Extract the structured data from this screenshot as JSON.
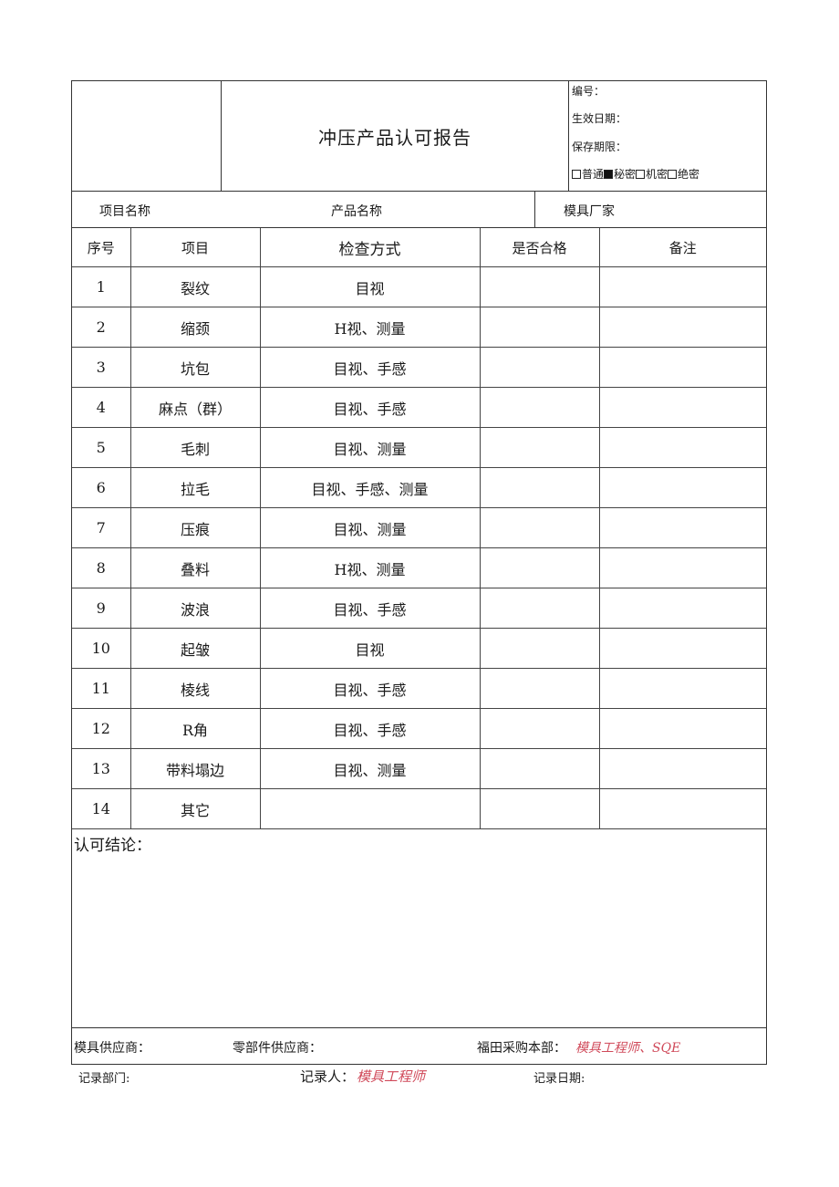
{
  "header": {
    "title": "冲压产品认可报告",
    "meta": {
      "number_label": "编号：",
      "effective_date_label": "生效日期：",
      "retention_label": "保存期限：",
      "classification": [
        {
          "label": "普通",
          "checked": false
        },
        {
          "label": "秘密",
          "checked": true
        },
        {
          "label": "机密",
          "checked": false
        },
        {
          "label": "绝密",
          "checked": false
        }
      ]
    }
  },
  "info": {
    "project_name_label": "项目名称",
    "product_name_label": "产品名称",
    "die_maker_label": "模具厂家"
  },
  "table": {
    "columns": [
      "序号",
      "项目",
      "检查方式",
      "是否合格",
      "备注"
    ],
    "rows": [
      {
        "no": "1",
        "item": "裂纹",
        "method": "目视",
        "pass": "",
        "remark": ""
      },
      {
        "no": "2",
        "item": "缩颈",
        "method": "H视、测量",
        "pass": "",
        "remark": ""
      },
      {
        "no": "3",
        "item": "坑包",
        "method": "目视、手感",
        "pass": "",
        "remark": ""
      },
      {
        "no": "4",
        "item": "麻点（群）",
        "method": "目视、手感",
        "pass": "",
        "remark": ""
      },
      {
        "no": "5",
        "item": "毛刺",
        "method": "目视、测量",
        "pass": "",
        "remark": ""
      },
      {
        "no": "6",
        "item": "拉毛",
        "method": "目视、手感、测量",
        "pass": "",
        "remark": ""
      },
      {
        "no": "7",
        "item": "压痕",
        "method": "目视、测量",
        "pass": "",
        "remark": ""
      },
      {
        "no": "8",
        "item": "叠料",
        "method": "H视、测量",
        "pass": "",
        "remark": ""
      },
      {
        "no": "9",
        "item": "波浪",
        "method": "目视、手感",
        "pass": "",
        "remark": ""
      },
      {
        "no": "10",
        "item": "起皱",
        "method": "目视",
        "pass": "",
        "remark": ""
      },
      {
        "no": "11",
        "item": "棱线",
        "method": "目视、手感",
        "pass": "",
        "remark": ""
      },
      {
        "no": "12",
        "item": "R角",
        "method": "目视、手感",
        "pass": "",
        "remark": ""
      },
      {
        "no": "13",
        "item": "带料塌边",
        "method": "目视、测量",
        "pass": "",
        "remark": ""
      },
      {
        "no": "14",
        "item": "其它",
        "method": "",
        "pass": "",
        "remark": ""
      }
    ]
  },
  "conclusion": {
    "label": "认可结论："
  },
  "signatures": {
    "die_supplier_label": "模具供应商：",
    "parts_supplier_label": "零部件供应商：",
    "purchasing_label": "福田采购本部：",
    "purchasing_value": "模具工程师、SQE"
  },
  "footer": {
    "record_dept_label": "记录部门:",
    "recorder_label": "记录人：",
    "recorder_value": "模具工程师",
    "record_date_label": "记录日期:"
  }
}
